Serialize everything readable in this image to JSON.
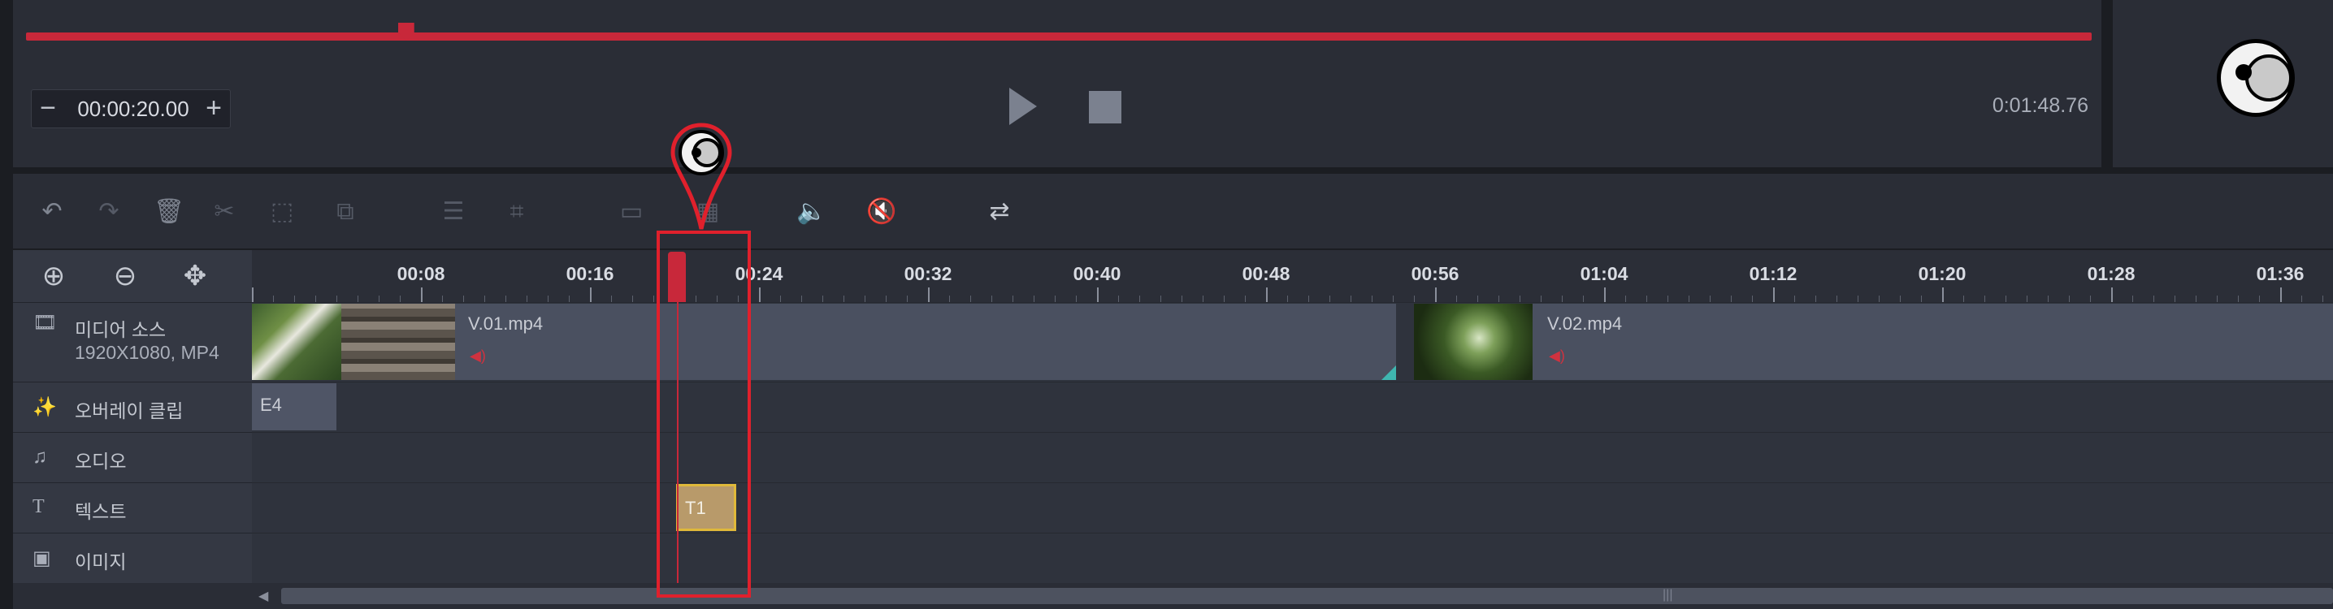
{
  "preview": {
    "current_time": "00:00:20.00",
    "duration": "0:01:48.76",
    "minus": "−",
    "plus": "+",
    "progress_fraction": 0.184
  },
  "zoom": {
    "zoom_in": "⊕",
    "zoom_out": "⊖",
    "fit": "✥"
  },
  "ruler": {
    "labels": [
      "00:08",
      "00:16",
      "00:24",
      "00:32",
      "00:40",
      "00:48",
      "00:56",
      "01:04",
      "01:12",
      "01:20",
      "01:28",
      "01:36"
    ]
  },
  "tracks": [
    {
      "icon": "film-icon",
      "glyph": "🎞",
      "label": "미디어 소스",
      "sublabel": "1920X1080, MP4"
    },
    {
      "icon": "magic-wand-icon",
      "glyph": "✨",
      "label": "오버레이 클립"
    },
    {
      "icon": "music-note-icon",
      "glyph": "♫",
      "label": "오디오"
    },
    {
      "icon": "text-icon",
      "glyph": "T",
      "label": "텍스트"
    },
    {
      "icon": "image-icon",
      "glyph": "▣",
      "label": "이미지"
    }
  ],
  "clips": {
    "video1": "V.01.mp4",
    "video2": "V.02.mp4",
    "overlay": "E4",
    "text": "T1"
  },
  "colors": {
    "accent": "#c8283a",
    "text_clip": "#b89a6a",
    "text_clip_border": "#e0b93a"
  }
}
